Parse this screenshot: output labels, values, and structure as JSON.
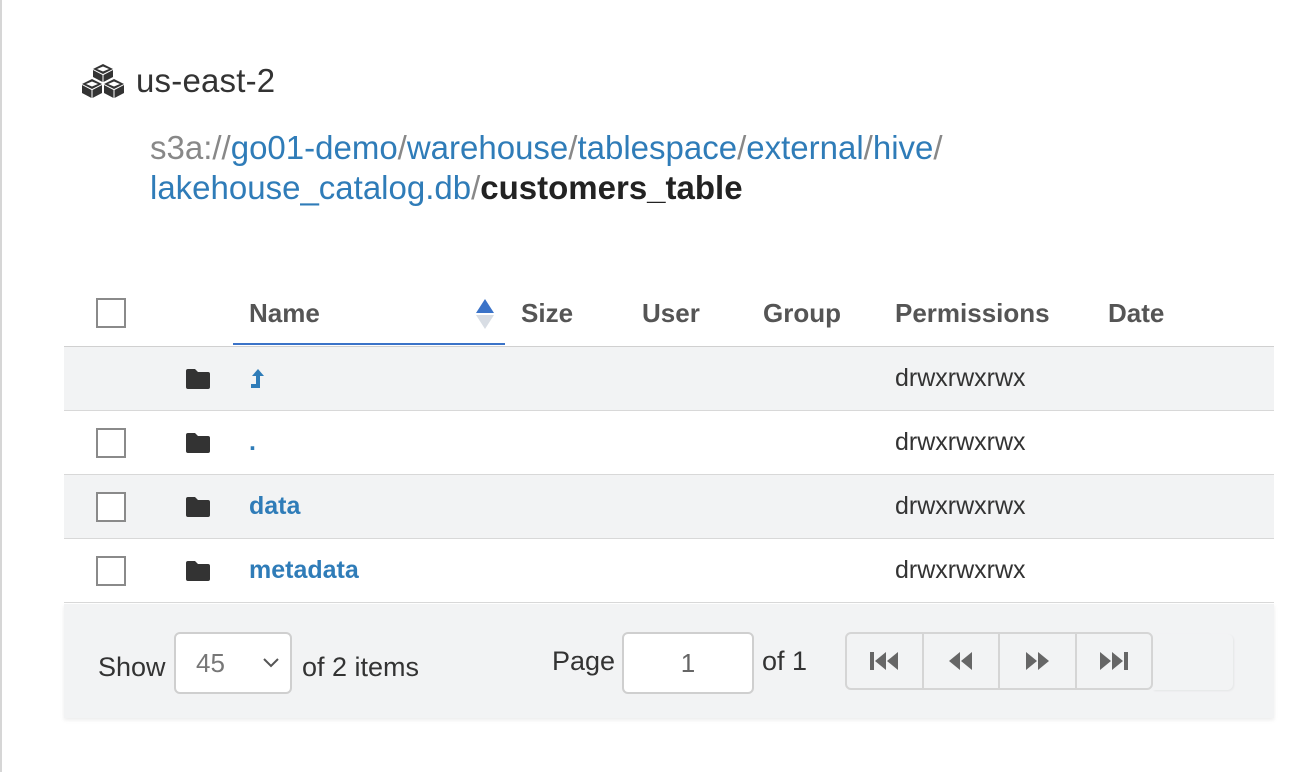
{
  "region": {
    "label": "us-east-2",
    "icon": "cubes-icon"
  },
  "breadcrumb": {
    "scheme": "s3a://",
    "segments": [
      "go01-demo",
      "warehouse",
      "tablespace",
      "external",
      "hive",
      "lakehouse_catalog.db"
    ],
    "separator": "/",
    "current": "customers_table"
  },
  "table": {
    "columns": {
      "name": "Name",
      "size": "Size",
      "user": "User",
      "group": "Group",
      "permissions": "Permissions",
      "date": "Date"
    },
    "sort": {
      "column": "Name",
      "direction": "ascending"
    },
    "rows": [
      {
        "name": "↰",
        "type": "parent-folder",
        "permissions": "drwxrwxrwx",
        "selectable": false
      },
      {
        "name": ".",
        "type": "folder",
        "permissions": "drwxrwxrwx",
        "selectable": true
      },
      {
        "name": "data",
        "type": "folder",
        "permissions": "drwxrwxrwx",
        "selectable": true
      },
      {
        "name": "metadata",
        "type": "folder",
        "permissions": "drwxrwxrwx",
        "selectable": true
      }
    ]
  },
  "pagination": {
    "show_label": "Show",
    "page_size": "45",
    "items_label": "of 2 items",
    "page_label": "Page",
    "current_page": "1",
    "total_label": "of 1"
  },
  "colors": {
    "link": "#2f7cb8",
    "sort_accent": "#3b73c8",
    "row_alt": "#f2f3f4"
  }
}
